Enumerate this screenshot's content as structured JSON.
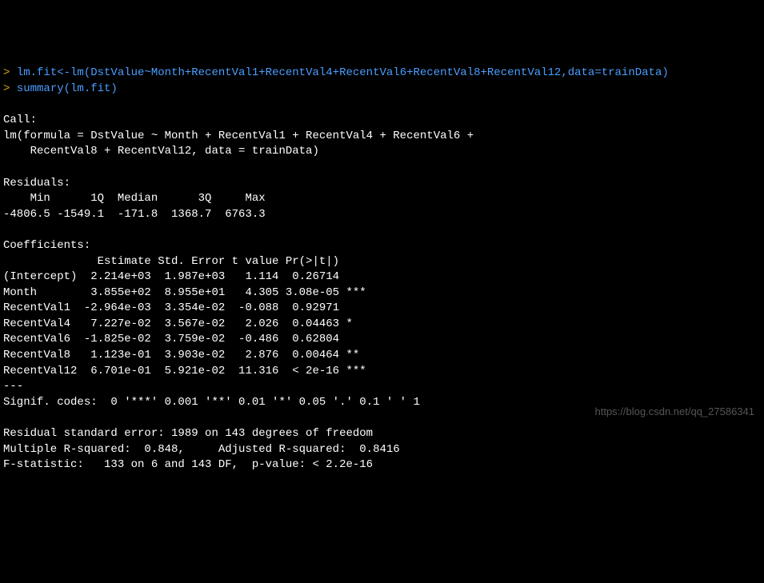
{
  "line1_prompt": "> ",
  "line1_cmd": "lm.fit<-lm(DstValue~Month+RecentVal1+RecentVal4+RecentVal6+RecentVal8+RecentVal12,data=trainData)",
  "line2_prompt": "> ",
  "line2_cmd": "summary(lm.fit)",
  "blank": "",
  "call_label": "Call:",
  "call_line1": "lm(formula = DstValue ~ Month + RecentVal1 + RecentVal4 + RecentVal6 + ",
  "call_line2": "    RecentVal8 + RecentVal12, data = trainData)",
  "residuals_label": "Residuals:",
  "residuals_header": "    Min      1Q  Median      3Q     Max ",
  "residuals_values": "-4806.5 -1549.1  -171.8  1368.7  6763.3 ",
  "coef_label": "Coefficients:",
  "coef_header": "              Estimate Std. Error t value Pr(>|t|)    ",
  "coef_intercept": "(Intercept)  2.214e+03  1.987e+03   1.114  0.26714    ",
  "coef_month": "Month        3.855e+02  8.955e+01   4.305 3.08e-05 ***",
  "coef_rv1": "RecentVal1  -2.964e-03  3.354e-02  -0.088  0.92971    ",
  "coef_rv4": "RecentVal4   7.227e-02  3.567e-02   2.026  0.04463 *  ",
  "coef_rv6": "RecentVal6  -1.825e-02  3.759e-02  -0.486  0.62804    ",
  "coef_rv8": "RecentVal8   1.123e-01  3.903e-02   2.876  0.00464 ** ",
  "coef_rv12": "RecentVal12  6.701e-01  5.921e-02  11.316  < 2e-16 ***",
  "sep": "---",
  "signif": "Signif. codes:  0 '***' 0.001 '**' 0.01 '*' 0.05 '.' 0.1 ' ' 1",
  "rse": "Residual standard error: 1989 on 143 degrees of freedom",
  "rsq": "Multiple R-squared:  0.848,\tAdjusted R-squared:  0.8416 ",
  "fstat": "F-statistic:   133 on 6 and 143 DF,  p-value: < 2.2e-16",
  "watermark": "https://blog.csdn.net/qq_27586341"
}
